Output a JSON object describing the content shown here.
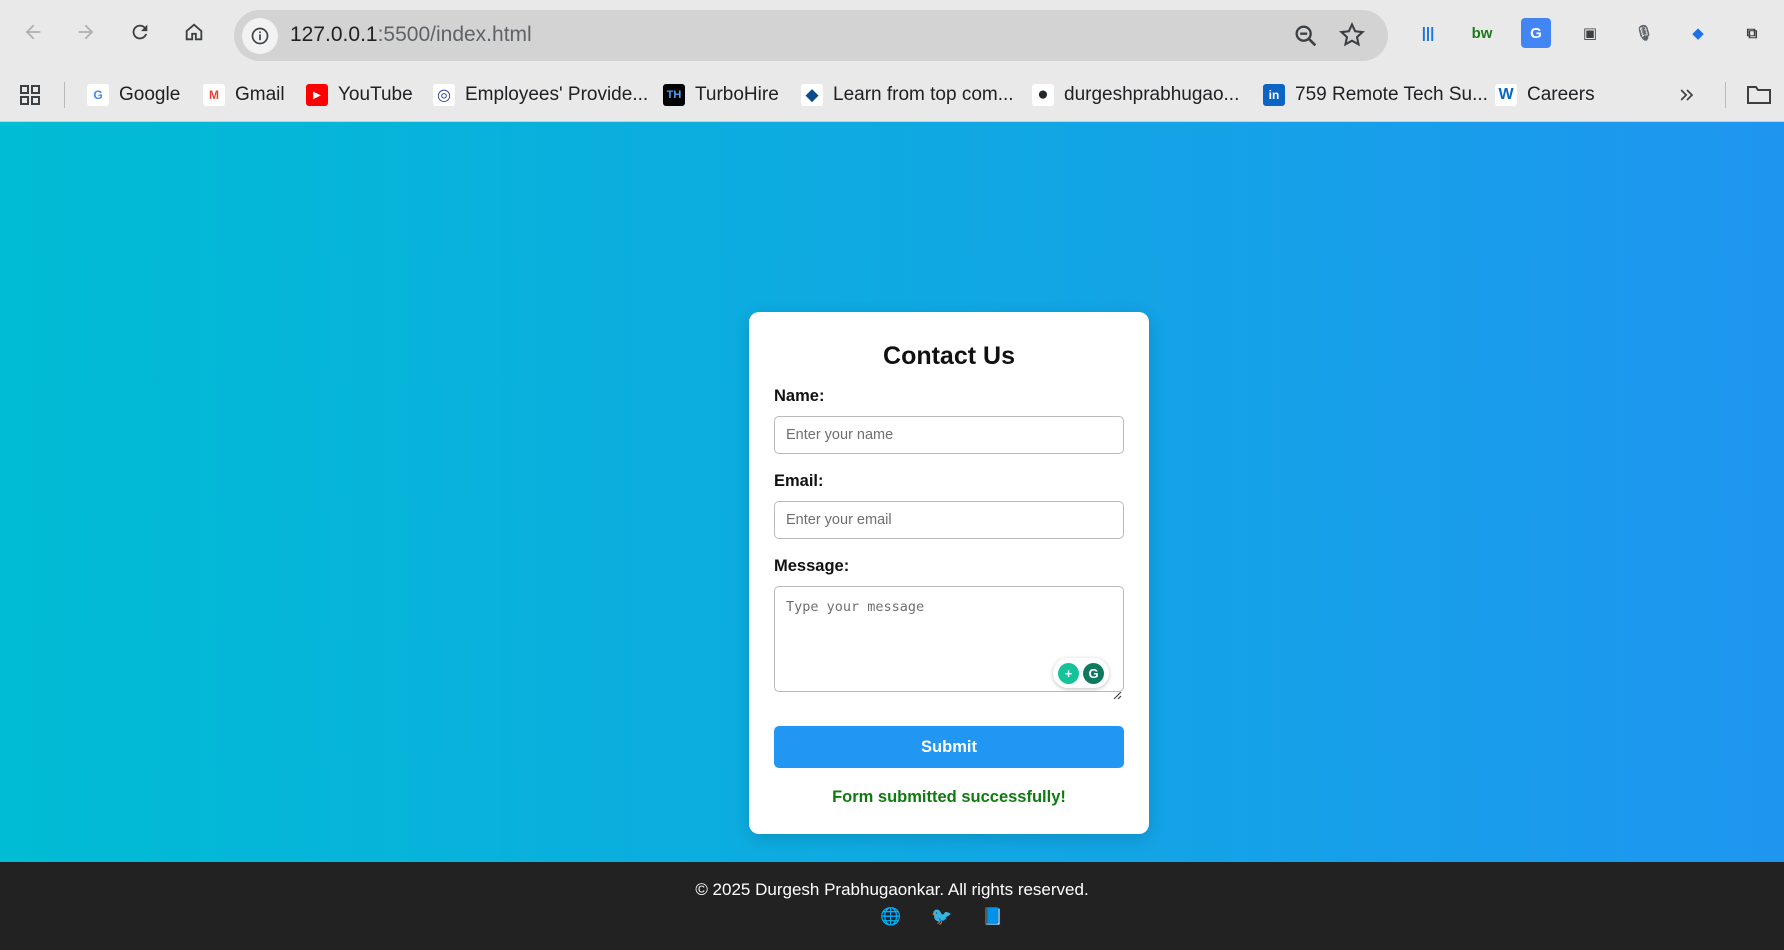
{
  "browser": {
    "url_host": "127.0.0.1",
    "url_rest": ":5500/index.html",
    "icons": [
      "back-arrow",
      "forward-arrow",
      "reload",
      "home",
      "site-info",
      "zoom",
      "bookmark-star"
    ],
    "extensions": [
      {
        "name": "barcode-extension-icon",
        "glyph": "|||",
        "color": "#1a73e8"
      },
      {
        "name": "bw-extension-icon",
        "glyph": "bw",
        "color": "#1b7a1b"
      },
      {
        "name": "google-translate-icon",
        "glyph": "G",
        "color": "#4285f4"
      },
      {
        "name": "reader-extension-icon",
        "glyph": "▣",
        "color": "#3c4043"
      },
      {
        "name": "microphone-icon",
        "glyph": "🎙",
        "color": "#5f6368"
      },
      {
        "name": "blue-extension-icon",
        "glyph": "◆",
        "color": "#1a73e8"
      },
      {
        "name": "extensions-puzzle-icon",
        "glyph": "⧉",
        "color": "#3c4043"
      }
    ]
  },
  "bookmarks": [
    {
      "label": "Google",
      "icon": "G",
      "bg": "#ffffff",
      "fg": "#4285f4"
    },
    {
      "label": "Gmail",
      "icon": "M",
      "bg": "#ffffff",
      "fg": "#ea4335"
    },
    {
      "label": "YouTube",
      "icon": "▶",
      "bg": "#ff0000",
      "fg": "#ffffff"
    },
    {
      "label": "Employees' Provide...",
      "icon": "◎",
      "bg": "#ffffff",
      "fg": "#2a3f8c"
    },
    {
      "label": "TurboHire",
      "icon": "TH",
      "bg": "#000000",
      "fg": "#4aa3ff"
    },
    {
      "label": "Learn from top com...",
      "icon": "◆",
      "bg": "#ffffff",
      "fg": "#0b4a8b"
    },
    {
      "label": "durgeshprabhugao...",
      "icon": "●",
      "bg": "#ffffff",
      "fg": "#24292e"
    },
    {
      "label": "759 Remote Tech Su...",
      "icon": "in",
      "bg": "#0a66c2",
      "fg": "#ffffff"
    },
    {
      "label": "Careers",
      "icon": "W",
      "bg": "#ffffff",
      "fg": "#0a66c2"
    }
  ],
  "form": {
    "title": "Contact Us",
    "name_label": "Name:",
    "name_placeholder": "Enter your name",
    "email_label": "Email:",
    "email_placeholder": "Enter your email",
    "message_label": "Message:",
    "message_placeholder": "Type your message",
    "submit_label": "Submit",
    "success_message": "Form submitted successfully!"
  },
  "footer": {
    "copyright": "© 2025 Durgesh Prabhugaonkar. All rights reserved.",
    "social": [
      {
        "name": "globe-icon",
        "glyph": "🌐"
      },
      {
        "name": "bird-icon",
        "glyph": "🐦"
      },
      {
        "name": "book-icon",
        "glyph": "📘"
      }
    ]
  },
  "colors": {
    "gradient_start": "#00bcd4",
    "gradient_end": "#1e96f0",
    "submit": "#2196f3",
    "success": "#0f7a0f",
    "footer_bg": "#222222"
  }
}
